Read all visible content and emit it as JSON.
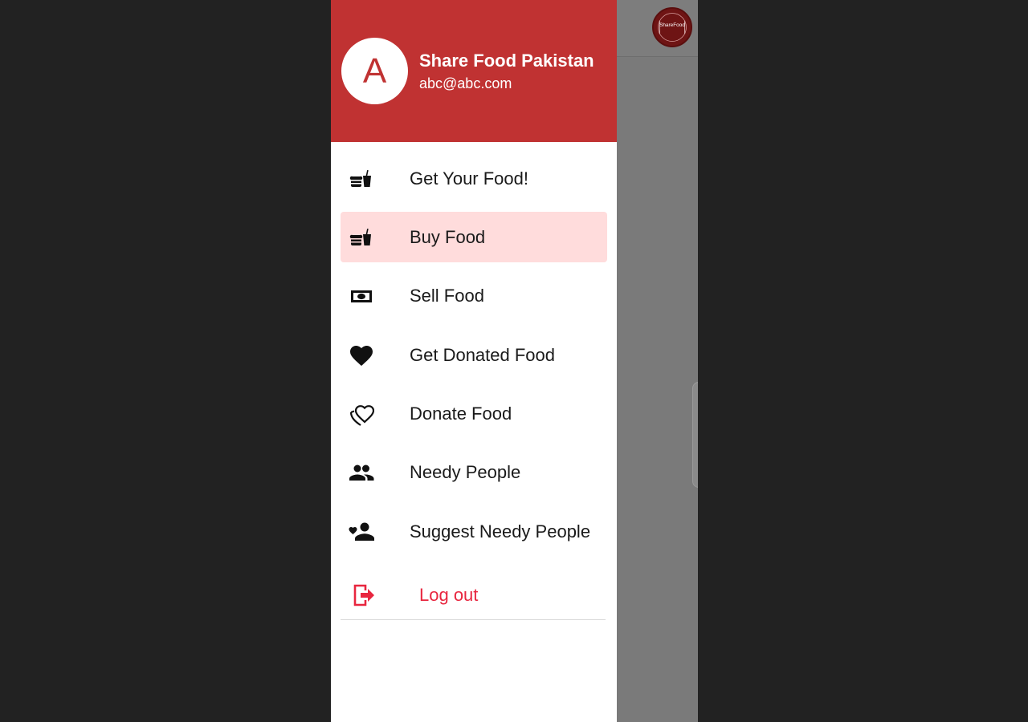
{
  "colors": {
    "primary": "#c03232",
    "active_item_bg": "#ffdcdc",
    "logout_red": "#e8263f",
    "scrim": "#7a7a7a",
    "outer_bg": "#222222"
  },
  "app_bar": {
    "logo_icon": "sharefood-logo-icon",
    "logo_text": "ShareFood"
  },
  "drawer": {
    "header": {
      "avatar_letter": "A",
      "app_name": "Share Food Pakistan",
      "email": "abc@abc.com"
    },
    "items": [
      {
        "label": "Get Your Food!",
        "icon": "fastfood-icon",
        "active": false
      },
      {
        "label": "Buy Food",
        "icon": "fastfood-icon",
        "active": true
      },
      {
        "label": "Sell Food",
        "icon": "money-icon",
        "active": false
      },
      {
        "label": "Get Donated Food",
        "icon": "heart-icon",
        "active": false
      },
      {
        "label": "Donate Food",
        "icon": "volunteer-heart-icon",
        "active": false
      },
      {
        "label": "Needy People",
        "icon": "people-icon",
        "active": false
      },
      {
        "label": "Suggest Needy People",
        "icon": "person-heart-icon",
        "active": false
      }
    ],
    "logout": {
      "label": "Log out",
      "icon": "logout-icon"
    }
  }
}
